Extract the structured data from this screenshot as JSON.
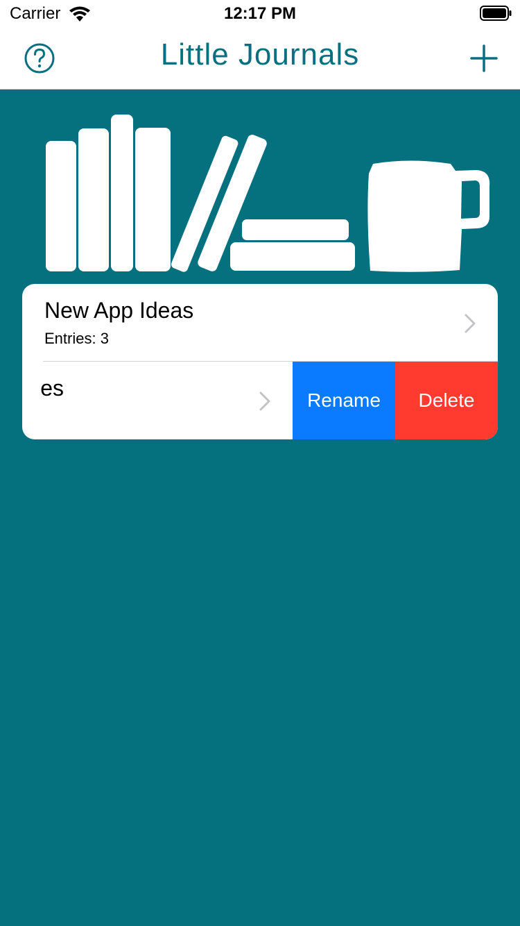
{
  "status_bar": {
    "carrier": "Carrier",
    "time": "12:17 PM",
    "wifi_icon": "wifi-icon",
    "battery_icon": "battery-icon"
  },
  "nav": {
    "title": "Little Journals",
    "help_icon": "question-circle-icon",
    "add_icon": "plus-icon"
  },
  "colors": {
    "background": "#05707e",
    "title": "#0a6f80",
    "rename": "#0a7aff",
    "delete": "#ff3b30"
  },
  "journals": [
    {
      "title": "New App Ideas",
      "entries_label": "Entries: 3"
    },
    {
      "title_visible": "es"
    }
  ],
  "swipe_actions": {
    "rename_label": "Rename",
    "delete_label": "Delete"
  }
}
